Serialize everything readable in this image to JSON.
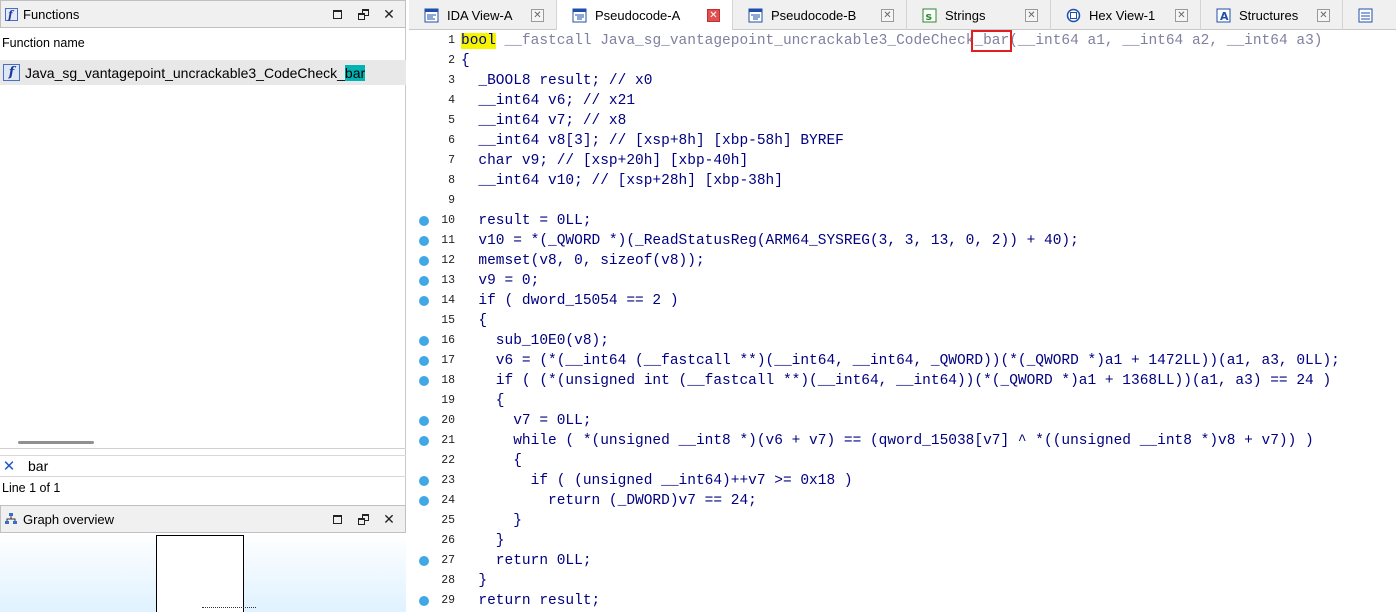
{
  "functions_panel": {
    "title": "Functions",
    "column_header": "Function name",
    "selected_function": {
      "name_prefix": "Java_sg_vantagepoint_uncrackable3_CodeCheck_",
      "name_match": "bar"
    },
    "filter_text": "bar",
    "status": "Line 1 of 1"
  },
  "graph_panel": {
    "title": "Graph overview"
  },
  "tabs": [
    {
      "label": "IDA View-A",
      "icon": "ida-view-icon",
      "active": false
    },
    {
      "label": "Pseudocode-A",
      "icon": "pseudocode-icon",
      "active": true
    },
    {
      "label": "Pseudocode-B",
      "icon": "pseudocode-icon",
      "active": false
    },
    {
      "label": "Strings",
      "icon": "strings-icon",
      "active": false
    },
    {
      "label": "Hex View-1",
      "icon": "hex-view-icon",
      "active": false
    },
    {
      "label": "Structures",
      "icon": "structures-icon",
      "active": false
    }
  ],
  "code_lines": [
    {
      "n": "1",
      "bp": false
    },
    {
      "n": "2",
      "bp": false,
      "t": "{"
    },
    {
      "n": "3",
      "bp": false,
      "t": "  _BOOL8 result; // x0"
    },
    {
      "n": "4",
      "bp": false,
      "t": "  __int64 v6; // x21"
    },
    {
      "n": "5",
      "bp": false,
      "t": "  __int64 v7; // x8"
    },
    {
      "n": "6",
      "bp": false,
      "t": "  __int64 v8[3]; // [xsp+8h] [xbp-58h] BYREF"
    },
    {
      "n": "7",
      "bp": false,
      "t": "  char v9; // [xsp+20h] [xbp-40h]"
    },
    {
      "n": "8",
      "bp": false,
      "t": "  __int64 v10; // [xsp+28h] [xbp-38h]"
    },
    {
      "n": "9",
      "bp": false,
      "t": ""
    },
    {
      "n": "10",
      "bp": true,
      "t": "  result = 0LL;"
    },
    {
      "n": "11",
      "bp": true,
      "t": "  v10 = *(_QWORD *)(_ReadStatusReg(ARM64_SYSREG(3, 3, 13, 0, 2)) + 40);"
    },
    {
      "n": "12",
      "bp": true,
      "t": "  memset(v8, 0, sizeof(v8));"
    },
    {
      "n": "13",
      "bp": true,
      "t": "  v9 = 0;"
    },
    {
      "n": "14",
      "bp": true,
      "t": "  if ( dword_15054 == 2 )"
    },
    {
      "n": "15",
      "bp": false,
      "t": "  {"
    },
    {
      "n": "16",
      "bp": true,
      "t": "    sub_10E0(v8);"
    },
    {
      "n": "17",
      "bp": true,
      "t": "    v6 = (*(__int64 (__fastcall **)(__int64, __int64, _QWORD))(*(_QWORD *)a1 + 1472LL))(a1, a3, 0LL);"
    },
    {
      "n": "18",
      "bp": true,
      "t": "    if ( (*(unsigned int (__fastcall **)(__int64, __int64))(*(_QWORD *)a1 + 1368LL))(a1, a3) == 24 )"
    },
    {
      "n": "19",
      "bp": false,
      "t": "    {"
    },
    {
      "n": "20",
      "bp": true,
      "t": "      v7 = 0LL;"
    },
    {
      "n": "21",
      "bp": true,
      "t": "      while ( *(unsigned __int8 *)(v6 + v7) == (qword_15038[v7] ^ *((unsigned __int8 *)v8 + v7)) )"
    },
    {
      "n": "22",
      "bp": false,
      "t": "      {"
    },
    {
      "n": "23",
      "bp": true,
      "t": "        if ( (unsigned __int64)++v7 >= 0x18 )"
    },
    {
      "n": "24",
      "bp": true,
      "t": "          return (_DWORD)v7 == 24;"
    },
    {
      "n": "25",
      "bp": false,
      "t": "      }"
    },
    {
      "n": "26",
      "bp": false,
      "t": "    }"
    },
    {
      "n": "27",
      "bp": true,
      "t": "    return 0LL;"
    },
    {
      "n": "28",
      "bp": false,
      "t": "  }"
    },
    {
      "n": "29",
      "bp": true,
      "t": "  return result;"
    }
  ],
  "signature": {
    "ret_type": "bool",
    "call_conv": " __fastcall ",
    "name_prefix": "Java_sg_vantagepoint_uncrackable3_CodeCheck",
    "name_suffix": "_bar",
    "params": "(__int64 a1, __int64 a2, __int64 a3)"
  },
  "colors": {
    "accent_highlight": "#00b4b4",
    "keyword_highlight": "#f5f500",
    "breakpoint_dot": "#41a8e6",
    "selection_box": "#e02020"
  }
}
